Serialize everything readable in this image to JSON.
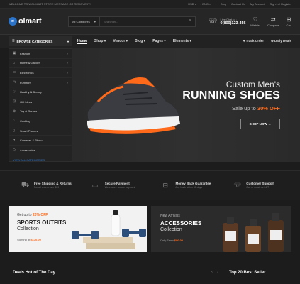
{
  "topbar": {
    "welcome": "WELCOME TO WOLMART STORE MESSAGE OR REMOVE IT!",
    "currency": "USD",
    "language": "ENG",
    "links": [
      "Blog",
      "Contact Us",
      "My Account",
      "Sign in / Register"
    ]
  },
  "header": {
    "logo_badge": "≋",
    "logo_text": "olmart",
    "search_category": "All Categories",
    "search_placeholder": "Search in...",
    "live_chat_label": "Live Chat or :",
    "phone": "0(800)123-456",
    "icons": [
      {
        "label": "Wishlist",
        "icon": "heart-icon"
      },
      {
        "label": "Compare",
        "icon": "compare-icon"
      },
      {
        "label": "Cart",
        "icon": "cart-icon"
      }
    ]
  },
  "nav": {
    "browse_label": "BROWSE CATEGORIES",
    "menu": [
      "Home",
      "Shop",
      "Vendor",
      "Blog",
      "Pages",
      "Elements"
    ],
    "track_order": "Track Order",
    "daily_deals": "Daily Deals"
  },
  "sidebar": {
    "items": [
      {
        "label": "Fashion",
        "icon": "shirt-icon",
        "arrow": true
      },
      {
        "label": "Home & Garden",
        "icon": "home-icon",
        "arrow": true
      },
      {
        "label": "Electronics",
        "icon": "tv-icon",
        "arrow": true
      },
      {
        "label": "Furniture",
        "icon": "sofa-icon",
        "arrow": true
      },
      {
        "label": "Healthy & Beauty",
        "icon": "heart-icon",
        "arrow": false
      },
      {
        "label": "Gift Ideas",
        "icon": "gift-icon",
        "arrow": false
      },
      {
        "label": "Toy & Games",
        "icon": "gamepad-icon",
        "arrow": false
      },
      {
        "label": "Cooking",
        "icon": "cooking-icon",
        "arrow": false
      },
      {
        "label": "Smart Phones",
        "icon": "phone-icon",
        "arrow": false
      },
      {
        "label": "Cameras & Photo",
        "icon": "camera-icon",
        "arrow": false
      },
      {
        "label": "Accessories",
        "icon": "gem-icon",
        "arrow": false
      }
    ],
    "view_all": "VIEW ALL CATEGORIES"
  },
  "hero": {
    "line1": "Custom Men's",
    "line2": "RUNNING SHOES",
    "line3_prefix": "Sale up to",
    "line3_highlight": "30% OFF",
    "button": "SHOP NOW →"
  },
  "features": [
    {
      "title": "Free Shipping & Returns",
      "desc": "For all orders over $99",
      "icon": "truck-icon"
    },
    {
      "title": "Secure Payment",
      "desc": "We ensure secure payment",
      "icon": "card-icon"
    },
    {
      "title": "Money Back Guarantee",
      "desc": "Any back within 30 days",
      "icon": "money-icon"
    },
    {
      "title": "Customer Support",
      "desc": "Call or email us 24/7",
      "icon": "support-icon"
    }
  ],
  "promo1": {
    "line1_prefix": "Get up to",
    "line1_highlight": "20% OFF",
    "title": "SPORTS OUTFITS",
    "subtitle": "Collection",
    "price_prefix": "Starting at",
    "price": "$170.00"
  },
  "promo2": {
    "line1": "New Arrivals",
    "title": "ACCESSORIES",
    "subtitle": "Collection",
    "price_prefix": "Only From",
    "price": "$90.00"
  },
  "sections": {
    "deals": "Deals Hot of The Day",
    "best": "Top 20 Best Seller"
  },
  "colors": {
    "accent": "#ff6a1a",
    "brand": "#2a73c9"
  }
}
